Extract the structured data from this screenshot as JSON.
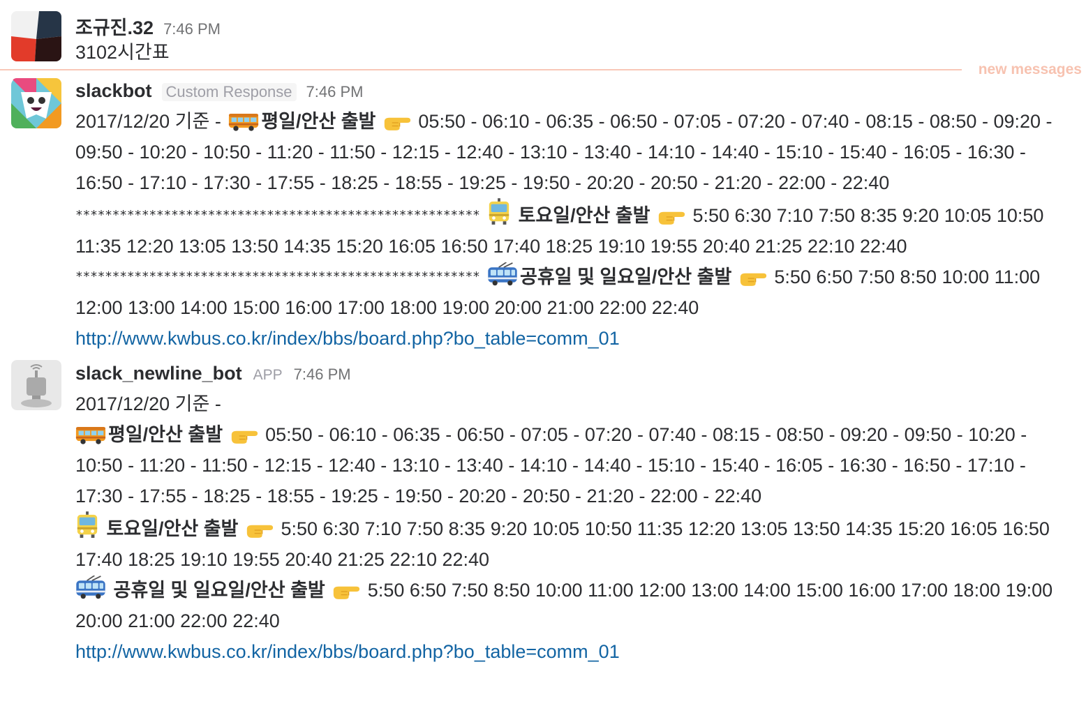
{
  "new_messages_label": "new messages",
  "messages": [
    {
      "author": "조규진.32",
      "time": "7:46 PM",
      "text": "3102시간표"
    },
    {
      "author": "slackbot",
      "tag": "Custom Response",
      "time": "7:46 PM",
      "date_prefix": "2017/12/20 기준 -",
      "weekday_label": "평일/안산 출발",
      "weekday_times": "05:50 - 06:10 - 06:35 - 06:50 - 07:05 - 07:20 - 07:40 - 08:15 - 08:50 - 09:20 - 09:50 - 10:20 - 10:50 - 11:20 - 11:50 - 12:15 - 12:40 - 13:10 - 13:40 - 14:10 - 14:40 - 15:10 - 15:40 - 16:05 - 16:30 - 16:50 - 17:10 - 17:30 - 17:55 - 18:25 - 18:55 - 19:25 - 19:50 - 20:20 - 20:50 - 21:20 - 22:00 - 22:40",
      "separator1": "*******************************************************",
      "saturday_label": "토요일/안산 출발",
      "saturday_times": "5:50 6:30 7:10 7:50 8:35 9:20 10:05 10:50 11:35 12:20 13:05 13:50 14:35 15:20 16:05 16:50 17:40 18:25 19:10 19:55 20:40 21:25 22:10 22:40",
      "separator2": "*******************************************************",
      "holiday_label": "공휴일 및 일요일/안산 출발",
      "holiday_times": "5:50 6:50 7:50 8:50 10:00 11:00 12:00 13:00 14:00 15:00 16:00 17:00 18:00 19:00 20:00 21:00 22:00 22:40",
      "link": "http://www.kwbus.co.kr/index/bbs/board.php?bo_table=comm_01"
    },
    {
      "author": "slack_newline_bot",
      "tag": "APP",
      "time": "7:46 PM",
      "date_prefix": "2017/12/20 기준 -",
      "weekday_label": "평일/안산 출발",
      "weekday_times": "05:50 - 06:10 - 06:35 - 06:50 - 07:05 - 07:20 - 07:40 - 08:15 - 08:50 - 09:20 - 09:50 - 10:20 - 10:50 - 11:20 - 11:50 - 12:15 - 12:40 - 13:10 - 13:40 - 14:10 - 14:40 - 15:10 - 15:40 - 16:05 - 16:30 - 16:50 - 17:10 - 17:30 - 17:55 - 18:25 - 18:55 - 19:25 - 19:50 - 20:20 - 20:50 - 21:20 - 22:00 - 22:40",
      "saturday_label": "토요일/안산 출발",
      "saturday_times": "5:50 6:30 7:10 7:50 8:35 9:20 10:05 10:50 11:35 12:20 13:05 13:50 14:35 15:20 16:05 16:50 17:40 18:25 19:10 19:55 20:40 21:25 22:10 22:40",
      "holiday_label": "공휴일 및 일요일/안산 출발",
      "holiday_times": "5:50 6:50 7:50 8:50 10:00 11:00 12:00 13:00 14:00 15:00 16:00 17:00 18:00 19:00 20:00 21:00 22:00 22:40",
      "link": "http://www.kwbus.co.kr/index/bbs/board.php?bo_table=comm_01"
    }
  ],
  "icons": {
    "bus": "bus-icon",
    "tram": "tram-icon",
    "trolleybus": "trolleybus-icon",
    "pointing": "pointing-right-icon"
  }
}
